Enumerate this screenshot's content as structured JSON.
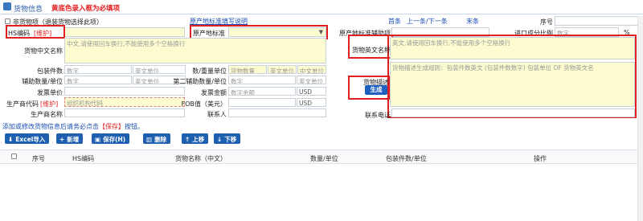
{
  "header": {
    "title": "货物信息",
    "note": "黄底色录入框为必填项"
  },
  "form": {
    "non_goods": "非货物项（退装货物选择此项）",
    "origin_link": "原产地标准填写说明",
    "nav": {
      "first": "首条",
      "prev_next": "上一条/下一条",
      "last": "末条"
    },
    "serial_label": "序号",
    "hs_code_label": "HS编码",
    "maintain": "[维护]",
    "origin_std_label": "原产地标准",
    "origin_std_aux_label": "原产地标准辅助项",
    "import_ratio_label": "进口成分比例",
    "import_ratio_placeholder": "数字",
    "percent": "%",
    "cn_name_label": "货物中文名称",
    "cn_name_placeholder": "中文,请使用回车换行,不能使用多个空格换行",
    "en_name_label": "货物英文名称",
    "en_name_placeholder": "英文,请使用回车换行,不能使用多个空格换行",
    "pkg_count_label": "包装件数",
    "num_placeholder": "数字",
    "unit_en": "英文单位",
    "qty_label": "数/重量单位",
    "qty_placeholder": "货物数量",
    "cn_unit": "中文单位",
    "aux_qty_label": "辅助数量/单位",
    "second_aux_label": "第二辅助数量/单位",
    "desc_label": "货物描述",
    "desc_placeholder": "货物描述生成规则：包装件数英文 (包装件数数字) 包装单位 OF 货物英文名",
    "generate": "生成",
    "invoice_price_label": "发票单价",
    "invoice_amount_label": "发票金额",
    "amount_placeholder": "数字金额",
    "usd": "USD",
    "manufacturer_code_label": "生产商代码",
    "org_placeholder": "组织机构代码",
    "fob_label": "FOB值（美元）",
    "manufacturer_label": "生产商名称",
    "contact_label": "联系人",
    "contact_phone_label": "联系电话"
  },
  "notice": {
    "prefix": "添加或修改货物信息后请务必点击",
    "save": "【保存】",
    "suffix": "按钮。"
  },
  "toolbar": {
    "excel": "Excel导入",
    "add": "新增",
    "save": "保存(H)",
    "delete": "删除",
    "up": "上移",
    "down": "下移"
  },
  "table": {
    "columns": [
      "序号",
      "HS编码",
      "货物名称（中文）",
      "数量/单位",
      "包装件数/单位",
      "操作"
    ]
  }
}
